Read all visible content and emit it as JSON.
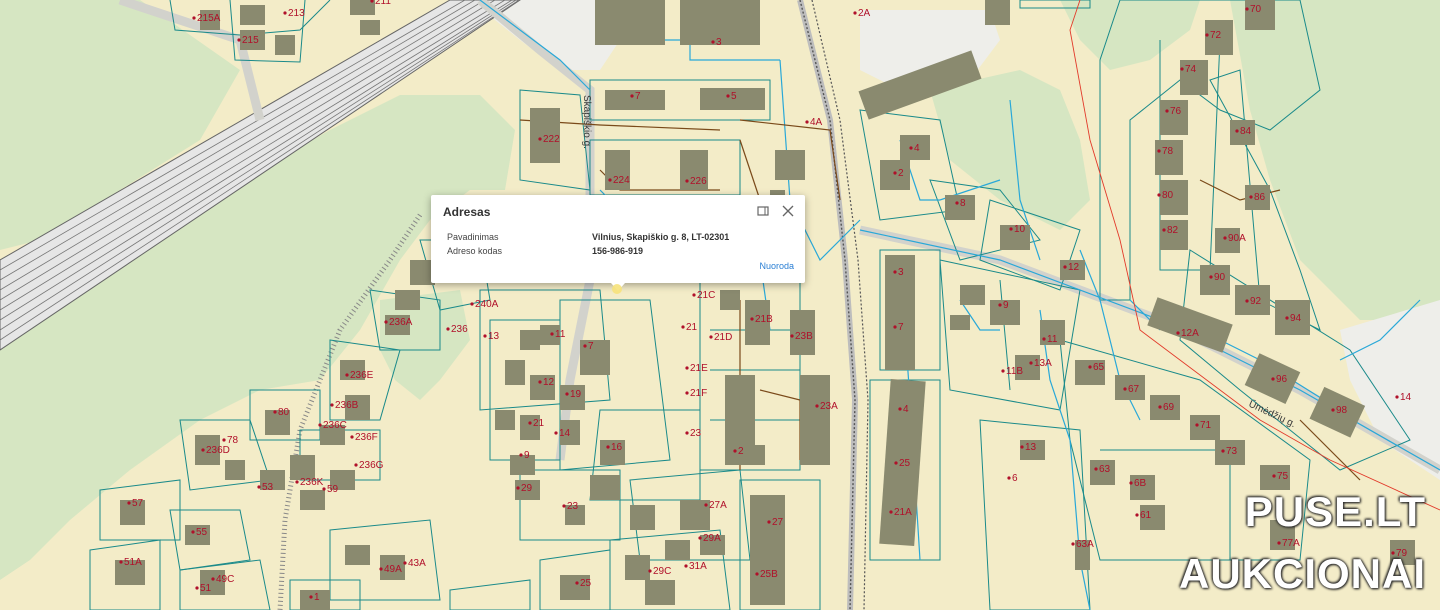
{
  "map": {
    "colors": {
      "land": "#f3ecc8",
      "forest": "#d6e6c2",
      "building": "#8a8a6f",
      "parcel": "#1a8a8a",
      "pipe": "#29a8d8",
      "label": "#b0102a"
    },
    "street_labels": [
      "Skapiškio g.",
      "Ūmėdžių g."
    ],
    "house_numbers": [
      "215A",
      "213",
      "211",
      "215",
      "2A",
      "3",
      "7",
      "5",
      "222",
      "224",
      "226",
      "4A",
      "4",
      "2",
      "8",
      "10",
      "12",
      "9",
      "11",
      "13A",
      "11B",
      "12A",
      "70",
      "72",
      "74",
      "76",
      "78",
      "80",
      "82",
      "84",
      "86",
      "90A",
      "90",
      "92",
      "94",
      "96",
      "98",
      "14",
      "65",
      "67",
      "69",
      "71",
      "73",
      "75",
      "77A",
      "79",
      "63",
      "6B",
      "61",
      "63A",
      "13",
      "6",
      "21A",
      "21C",
      "21",
      "21B",
      "23B",
      "21D",
      "21E",
      "21F",
      "23",
      "23A",
      "2",
      "4",
      "25",
      "27",
      "25B",
      "27A",
      "29A",
      "29C",
      "31A",
      "25",
      "23",
      "29",
      "16",
      "14",
      "19",
      "21",
      "9",
      "12",
      "7",
      "11",
      "13",
      "240A",
      "236",
      "236A",
      "236E",
      "236B",
      "236C",
      "236F",
      "236G",
      "80",
      "78",
      "236D",
      "53",
      "236K",
      "59",
      "57",
      "55",
      "51A",
      "51",
      "49C",
      "49A",
      "43A",
      "1",
      "3",
      "7"
    ]
  },
  "popup": {
    "title": "Adresas",
    "rows": [
      {
        "key": "Pavadinimas",
        "value": "Vilnius, Skapiškio g. 8, LT-02301"
      },
      {
        "key": "Adreso kodas",
        "value": "156-986-919"
      }
    ],
    "link_label": "Nuoroda",
    "maximize_icon": "maximize-icon",
    "close_icon": "close-icon"
  },
  "watermark": {
    "line1": "PUSE.LT",
    "line2": "AUKCIONAI"
  }
}
